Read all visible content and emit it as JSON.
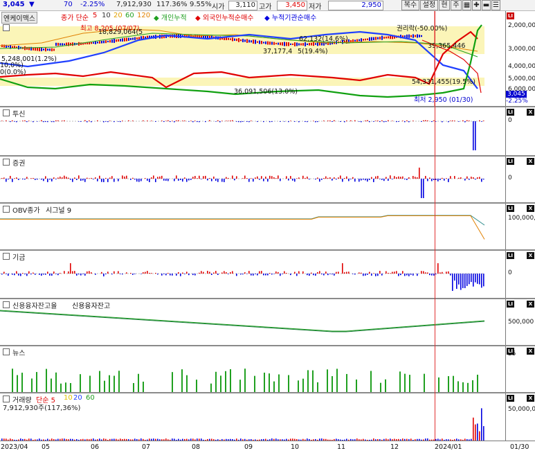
{
  "header": {
    "current_price": "3,045",
    "change": "70",
    "change_pct": "-2.25%",
    "volume": "7,912,930",
    "volume_ratio": "117.36%",
    "rate": "9.55%",
    "open_label": "시가",
    "open_value": "3,110",
    "high_label": "고가",
    "high_value": "3,450",
    "low_label": "저가",
    "low_value": "2,950",
    "buttons": {
      "restore": "복수",
      "settings": "설정",
      "current": "현",
      "note": "주"
    }
  },
  "price_pane": {
    "stock_name": "엔케이맥스",
    "ma_label": "종가 단순",
    "ma_periods": [
      "5",
      "10",
      "20",
      "60",
      "120"
    ],
    "legend": [
      "개인누적",
      "외국인누적순매수",
      "누적기관순매수"
    ],
    "annotations": {
      "high": "최고 8,205 (07/07)",
      "low": "최저 2,950 (01/30)",
      "rights_ex": "권리락(-50.00%)",
      "a1": "18,829,064(5",
      "a2": "5,248,001(1.2%)",
      "a3": "10,0%)",
      "a4": "0(0.0%)",
      "a5": "37,177,4",
      "a6": "5(19.4%)",
      "a7": "",
      "a8": "54,331,455(19.5%)",
      "a9": "36,091,506(13.0%)",
      "a10": "39,365,446",
      "a11": "62,132(14.6%)"
    },
    "axis": [
      "2,000,00",
      "3,000,00",
      "4,000,00",
      "5,000,00",
      "6,000,00"
    ],
    "last_badge": "3,045",
    "last_pct": "-2.25%"
  },
  "panes": [
    {
      "title": "투신",
      "axis": [
        "0"
      ]
    },
    {
      "title": "증권",
      "axis": [
        "0"
      ]
    },
    {
      "title": "OBV종가",
      "title2": "시그널 9",
      "axis": [
        "100,000,0"
      ]
    },
    {
      "title": "기금",
      "axis": [
        "0"
      ]
    },
    {
      "title": "신용융자잔고율",
      "title2": "신용융자잔고",
      "axis": [
        "500,000"
      ]
    },
    {
      "title": "뉴스",
      "axis": [
        "25"
      ]
    },
    {
      "title": "거래량",
      "title2": "단순 5",
      "periods": [
        "10",
        "20",
        "60"
      ],
      "subtitle": "7,912,930주(117,36%)",
      "axis": [
        "50,000,00"
      ]
    }
  ],
  "x_axis": [
    "2023/04",
    "05",
    "06",
    "07",
    "08",
    "09",
    "10",
    "11",
    "12",
    "2024/01",
    "01/30"
  ],
  "colors": {
    "up": "#e00000",
    "down": "#0000e0",
    "ma5": "#e00000",
    "ma10": "#f0c000",
    "ma20": "#2040ff",
    "ma60": "#20a020",
    "ma120": "#e08000",
    "highlight": "#fbf5b8"
  }
}
